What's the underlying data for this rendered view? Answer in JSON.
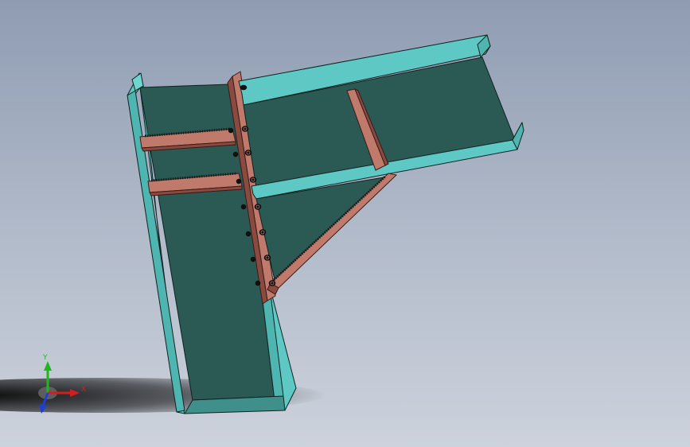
{
  "viewport": {
    "background_top": "#8f9cb2",
    "background_bottom": "#cdd2dc"
  },
  "model": {
    "steel_web_color": "#2b5a55",
    "steel_flange_color": "#5ec8c4",
    "steel_edge_color": "#0f2220",
    "plate_color": "#c07a6c",
    "plate_dark_color": "#8a4a40",
    "bolt_color": "#111111"
  },
  "triad": {
    "x_label": "X",
    "y_label": "Y",
    "z_label": "Z",
    "x_color": "#d11e1e",
    "y_color": "#1fb61f",
    "z_color": "#1f3fd1"
  }
}
